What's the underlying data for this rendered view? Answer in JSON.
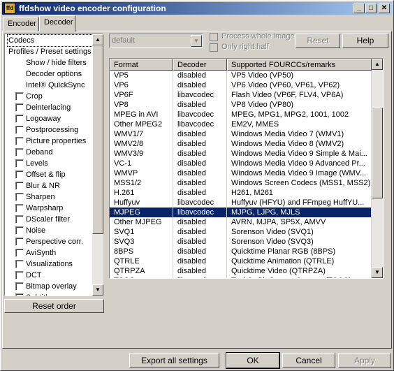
{
  "window": {
    "title": "ffdshow video encoder configuration",
    "icon_label": "ffd",
    "min_label": "_",
    "max_label": "□",
    "close_label": "✕"
  },
  "tabs": [
    {
      "label": "Encoder"
    },
    {
      "label": "Decoder"
    }
  ],
  "tree": [
    {
      "label": "Codecs",
      "indent": 0,
      "checkbox": false,
      "selected": true
    },
    {
      "label": "Profiles / Preset settings",
      "indent": 0,
      "checkbox": false
    },
    {
      "label": "Show / hide filters",
      "indent": 1,
      "checkbox": false
    },
    {
      "label": "Decoder options",
      "indent": 1,
      "checkbox": false
    },
    {
      "label": "Intel® QuickSync",
      "indent": 1,
      "checkbox": false
    },
    {
      "label": "Crop",
      "indent": 1,
      "checkbox": true
    },
    {
      "label": "Deinterlacing",
      "indent": 1,
      "checkbox": true
    },
    {
      "label": "Logoaway",
      "indent": 1,
      "checkbox": true
    },
    {
      "label": "Postprocessing",
      "indent": 1,
      "checkbox": true
    },
    {
      "label": "Picture properties",
      "indent": 1,
      "checkbox": true
    },
    {
      "label": "Deband",
      "indent": 1,
      "checkbox": true
    },
    {
      "label": "Levels",
      "indent": 1,
      "checkbox": true
    },
    {
      "label": "Offset & flip",
      "indent": 1,
      "checkbox": true
    },
    {
      "label": "Blur & NR",
      "indent": 1,
      "checkbox": true
    },
    {
      "label": "Sharpen",
      "indent": 1,
      "checkbox": true
    },
    {
      "label": "Warpsharp",
      "indent": 1,
      "checkbox": true
    },
    {
      "label": "DScaler filter",
      "indent": 1,
      "checkbox": true
    },
    {
      "label": "Noise",
      "indent": 1,
      "checkbox": true
    },
    {
      "label": "Perspective corr.",
      "indent": 1,
      "checkbox": true
    },
    {
      "label": "AviSynth",
      "indent": 1,
      "checkbox": true
    },
    {
      "label": "Visualizations",
      "indent": 1,
      "checkbox": true
    },
    {
      "label": "DCT",
      "indent": 1,
      "checkbox": true
    },
    {
      "label": "Bitmap overlay",
      "indent": 1,
      "checkbox": true
    },
    {
      "label": "Subtitles",
      "indent": 1,
      "checkbox": true
    }
  ],
  "reset_order_label": "Reset order",
  "preset_combo": {
    "value": "default"
  },
  "process_whole_image_label": "Process whole image",
  "only_right_half_label": "Only right half",
  "reset_label": "Reset",
  "help_label": "Help",
  "table": {
    "headers": [
      "Format",
      "Decoder",
      "Supported FOURCCs/remarks"
    ],
    "rows": [
      [
        "VP5",
        "disabled",
        "VP5 Video (VP50)"
      ],
      [
        "VP6",
        "disabled",
        "VP6 Video (VP60, VP61, VP62)"
      ],
      [
        "VP6F",
        "libavcodec",
        "Flash Video (VP6F, FLV4, VP6A)"
      ],
      [
        "VP8",
        "disabled",
        "VP8 Video (VP80)"
      ],
      [
        "MPEG in AVI",
        "libavcodec",
        "MPEG, MPG1, MPG2, 1001, 1002"
      ],
      [
        "Other MPEG2",
        "libavcodec",
        "EM2V, MMES"
      ],
      [
        "WMV1/7",
        "disabled",
        "Windows Media Video 7 (WMV1)"
      ],
      [
        "WMV2/8",
        "disabled",
        "Windows Media Video 8 (WMV2)"
      ],
      [
        "WMV3/9",
        "disabled",
        "Windows Media Video 9 Simple & Mai..."
      ],
      [
        "VC-1",
        "disabled",
        "Windows Media Video 9 Advanced Pr..."
      ],
      [
        "WMVP",
        "disabled",
        "Windows Media Video 9 Image (WMV..."
      ],
      [
        "MSS1/2",
        "disabled",
        "Windows Screen Codecs (MSS1, MSS2)"
      ],
      [
        "H.261",
        "disabled",
        "H261, M261"
      ],
      [
        "Huffyuv",
        "libavcodec",
        "Huffyuv (HFYU) and FFmpeg HuffYU..."
      ],
      [
        "MJPEG",
        "libavcodec",
        "MJPG, LJPG, MJLS"
      ],
      [
        "Other MJPEG",
        "disabled",
        "AVRN, MJPA, SP5X, AMVV"
      ],
      [
        "SVQ1",
        "disabled",
        "Sorenson Video (SVQ1)"
      ],
      [
        "SVQ3",
        "disabled",
        "Sorenson Video (SVQ3)"
      ],
      [
        "8BPS",
        "disabled",
        "Quicktime Planar RGB (8BPS)"
      ],
      [
        "QTRLE",
        "disabled",
        "Quicktime Animation (QTRLE)"
      ],
      [
        "QTRPZA",
        "disabled",
        "Quicktime Video (QTRPZA)"
      ],
      [
        "TSCC",
        "libavcodec",
        "TechSmith Screen Capture (TSCC)"
      ]
    ],
    "selected_row": 14
  },
  "bottom": {
    "export_label": "Export all settings",
    "ok_label": "OK",
    "cancel_label": "Cancel",
    "apply_label": "Apply"
  }
}
